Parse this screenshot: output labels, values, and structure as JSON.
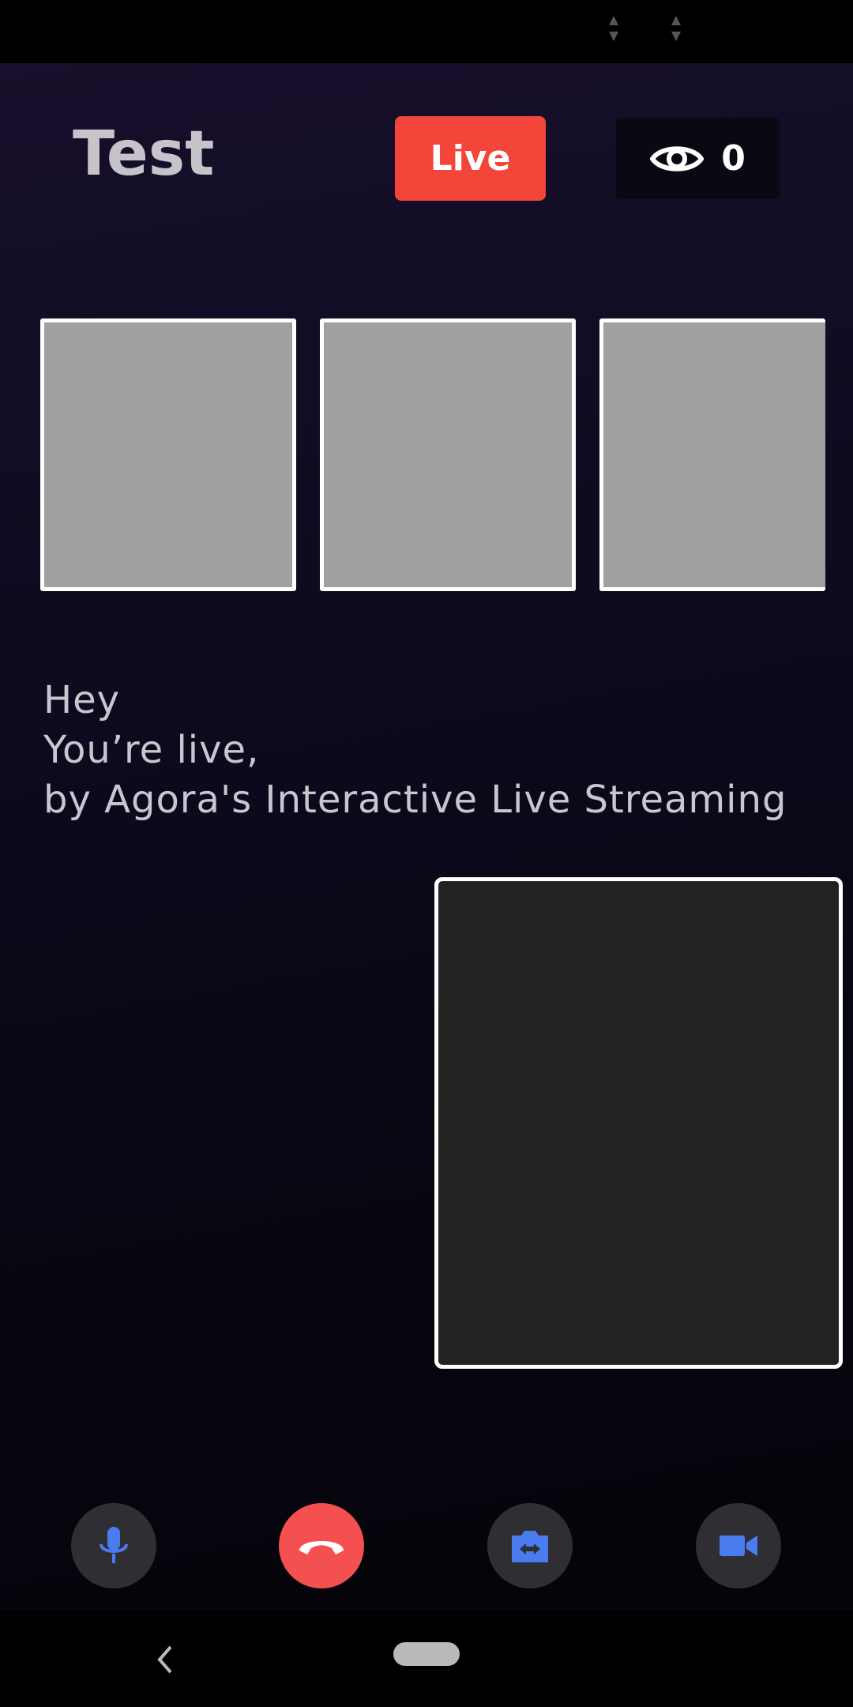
{
  "header": {
    "title": "Test",
    "live_label": "Live",
    "viewer_count": "0",
    "viewer_icon": "eye-icon"
  },
  "remote_thumbnails": [
    {
      "name": "remote-video-1"
    },
    {
      "name": "remote-video-2"
    },
    {
      "name": "remote-video-3"
    }
  ],
  "message": {
    "line1": "Hey",
    "line2": "You’re live,",
    "line3": "by Agora's Interactive Live Streaming"
  },
  "controls": [
    {
      "name": "mic-button",
      "icon": "microphone-icon",
      "color": "#4a7cf0"
    },
    {
      "name": "end-call-button",
      "icon": "hang-up-icon",
      "color": "#ffffff"
    },
    {
      "name": "switch-camera-button",
      "icon": "switch-camera-icon",
      "color": "#4a7cf0"
    },
    {
      "name": "video-toggle-button",
      "icon": "video-camera-icon",
      "color": "#4a7cf0"
    }
  ],
  "colors": {
    "live": "#f4453b",
    "end_call": "#f55050",
    "accent": "#4a7cf0",
    "control_bg": "#2f2f33"
  },
  "system_nav": {
    "back_icon": "back-chevron-icon",
    "home_icon": "home-pill-icon"
  }
}
